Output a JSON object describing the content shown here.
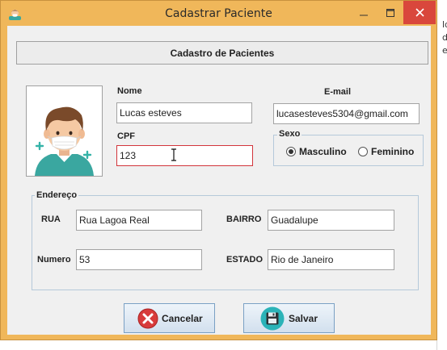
{
  "window": {
    "title": "Cadastrar Paciente",
    "colors": {
      "frame": "#f0b75a",
      "close": "#d9473c",
      "content": "#f0f0f0"
    }
  },
  "background_window": {
    "visible_chars": [
      "ld",
      "d",
      "e"
    ]
  },
  "header": {
    "label": "Cadastro de Pacientes"
  },
  "form": {
    "nome": {
      "label": "Nome",
      "value": "Lucas esteves"
    },
    "email": {
      "label": "E-mail",
      "value": "lucasesteves5304@gmail.com"
    },
    "cpf": {
      "label": "CPF",
      "value": "123",
      "error_color": "#d2353b"
    },
    "sexo": {
      "label": "Sexo",
      "options": [
        {
          "label": "Masculino",
          "selected": true
        },
        {
          "label": "Feminino",
          "selected": false
        }
      ]
    }
  },
  "endereco": {
    "label": "Endereço",
    "rua": {
      "label": "RUA",
      "value": "Rua Lagoa Real"
    },
    "bairro": {
      "label": "BAIRRO",
      "value": "Guadalupe"
    },
    "numero": {
      "label": "Numero",
      "value": "53"
    },
    "estado": {
      "label": "ESTADO",
      "value": "Rio de Janeiro"
    }
  },
  "buttons": {
    "cancel": {
      "label": "Cancelar",
      "icon": "cancel-icon"
    },
    "save": {
      "label": "Salvar",
      "icon": "floppy-disk-icon"
    }
  },
  "icons": {
    "app": "patient-avatar-icon",
    "photo": "patient-with-mask-icon",
    "minimize": "minimize-icon",
    "maximize": "maximize-icon",
    "close": "close-icon"
  }
}
